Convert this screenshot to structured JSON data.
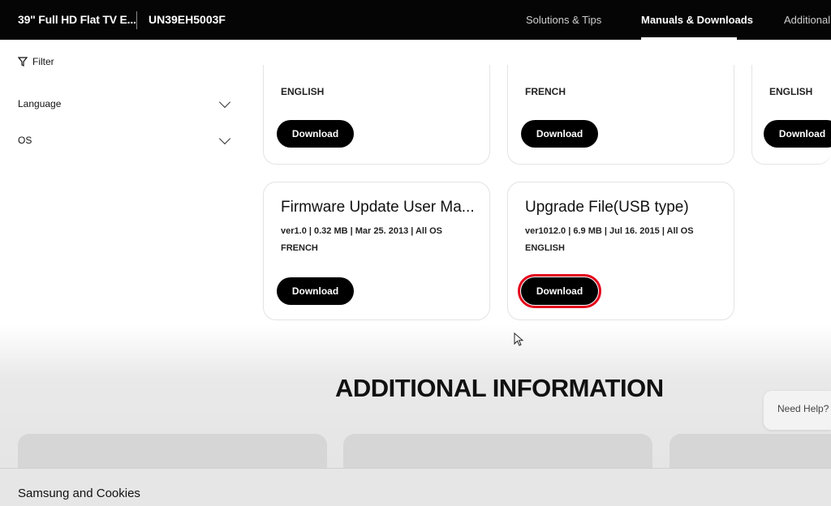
{
  "header": {
    "product_title": "39\" Full HD Flat TV E...",
    "model": "UN39EH5003F",
    "nav": [
      "Solutions & Tips",
      "Manuals & Downloads",
      "Additional"
    ]
  },
  "sidebar": {
    "filter_label": "Filter",
    "facets": [
      "Language",
      "OS"
    ]
  },
  "cards_top": [
    {
      "language": "ENGLISH",
      "button": "Download"
    },
    {
      "language": "FRENCH",
      "button": "Download"
    },
    {
      "language": "ENGLISH",
      "button": "Download"
    }
  ],
  "cards": [
    {
      "title": "Firmware Update User Ma...",
      "meta": "ver1.0 | 0.32 MB | Mar 25. 2013 | All OS",
      "language": "FRENCH",
      "button": "Download"
    },
    {
      "title": "Upgrade File(USB type)",
      "meta": "ver1012.0 | 6.9 MB | Jul 16. 2015 | All OS",
      "language": "ENGLISH",
      "button": "Download"
    }
  ],
  "section_title": "ADDITIONAL INFORMATION",
  "help_label": "Need Help?",
  "cookie_banner": "Samsung and Cookies",
  "colors": {
    "highlight": "#e3001b",
    "header_bg": "#050505"
  }
}
